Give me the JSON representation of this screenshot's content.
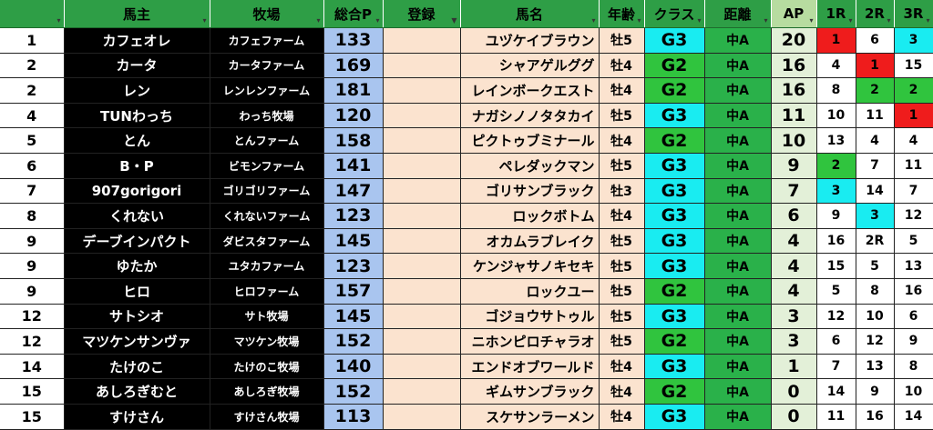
{
  "headers": {
    "rank": "",
    "owner": "馬主",
    "farm": "牧場",
    "points": "総合P",
    "register": "登録",
    "horse": "馬名",
    "age": "年齢",
    "class": "クラス",
    "distance": "距離",
    "ap": "AP",
    "r1": "1R",
    "r2": "2R",
    "r3": "3R"
  },
  "filter_icon": "▾",
  "rows": [
    {
      "rank": "1",
      "owner": "カフェオレ",
      "farm": "カフェファーム",
      "points": "133",
      "register": "",
      "horse": "ユヅケイブラウン",
      "age": "牡5",
      "class": "G3",
      "distance": "中A",
      "ap": "20",
      "r1": "1",
      "r2": "6",
      "r3": "3"
    },
    {
      "rank": "2",
      "owner": "カータ",
      "farm": "カータファーム",
      "points": "169",
      "register": "",
      "horse": "シャアゲルググ",
      "age": "牡4",
      "class": "G2",
      "distance": "中A",
      "ap": "16",
      "r1": "4",
      "r2": "1",
      "r3": "15"
    },
    {
      "rank": "2",
      "owner": "レン",
      "farm": "レンレンファーム",
      "points": "181",
      "register": "",
      "horse": "レインボークエスト",
      "age": "牡4",
      "class": "G2",
      "distance": "中A",
      "ap": "16",
      "r1": "8",
      "r2": "2",
      "r3": "2"
    },
    {
      "rank": "4",
      "owner": "TUNわっち",
      "farm": "わっち牧場",
      "points": "120",
      "register": "",
      "horse": "ナガシノノタタカイ",
      "age": "牡5",
      "class": "G3",
      "distance": "中A",
      "ap": "11",
      "r1": "10",
      "r2": "11",
      "r3": "1"
    },
    {
      "rank": "5",
      "owner": "とん",
      "farm": "とんファーム",
      "points": "158",
      "register": "",
      "horse": "ピクトゥブミナール",
      "age": "牡4",
      "class": "G2",
      "distance": "中A",
      "ap": "10",
      "r1": "13",
      "r2": "4",
      "r3": "4"
    },
    {
      "rank": "6",
      "owner": "B・P",
      "farm": "ビモンファーム",
      "points": "141",
      "register": "",
      "horse": "ペレダックマン",
      "age": "牡5",
      "class": "G3",
      "distance": "中A",
      "ap": "9",
      "r1": "2",
      "r2": "7",
      "r3": "11"
    },
    {
      "rank": "7",
      "owner": "907gorigori",
      "farm": "ゴリゴリファーム",
      "points": "147",
      "register": "",
      "horse": "ゴリサンブラック",
      "age": "牡3",
      "class": "G3",
      "distance": "中A",
      "ap": "7",
      "r1": "3",
      "r2": "14",
      "r3": "7"
    },
    {
      "rank": "8",
      "owner": "くれない",
      "farm": "くれないファーム",
      "points": "123",
      "register": "",
      "horse": "ロックボトム",
      "age": "牡4",
      "class": "G3",
      "distance": "中A",
      "ap": "6",
      "r1": "9",
      "r2": "3",
      "r3": "12"
    },
    {
      "rank": "9",
      "owner": "デーブインパクト",
      "farm": "ダビスタファーム",
      "points": "145",
      "register": "",
      "horse": "オカムラブレイク",
      "age": "牡5",
      "class": "G3",
      "distance": "中A",
      "ap": "4",
      "r1": "16",
      "r2": "2R",
      "r3": "5"
    },
    {
      "rank": "9",
      "owner": "ゆたか",
      "farm": "ユタカファーム",
      "points": "123",
      "register": "",
      "horse": "ケンジャサノキセキ",
      "age": "牡5",
      "class": "G3",
      "distance": "中A",
      "ap": "4",
      "r1": "15",
      "r2": "5",
      "r3": "13"
    },
    {
      "rank": "9",
      "owner": "ヒロ",
      "farm": "ヒロファーム",
      "points": "157",
      "register": "",
      "horse": "ロックユー",
      "age": "牡5",
      "class": "G2",
      "distance": "中A",
      "ap": "4",
      "r1": "5",
      "r2": "8",
      "r3": "16"
    },
    {
      "rank": "12",
      "owner": "サトシオ",
      "farm": "サト牧場",
      "points": "145",
      "register": "",
      "horse": "ゴジョウサトゥル",
      "age": "牡5",
      "class": "G3",
      "distance": "中A",
      "ap": "3",
      "r1": "12",
      "r2": "10",
      "r3": "6"
    },
    {
      "rank": "12",
      "owner": "マツケンサンヴァ",
      "farm": "マツケン牧場",
      "points": "152",
      "register": "",
      "horse": "ニホンピロチャラオ",
      "age": "牡5",
      "class": "G2",
      "distance": "中A",
      "ap": "3",
      "r1": "6",
      "r2": "12",
      "r3": "9"
    },
    {
      "rank": "14",
      "owner": "たけのこ",
      "farm": "たけのこ牧場",
      "points": "140",
      "register": "",
      "horse": "エンドオブワールド",
      "age": "牡4",
      "class": "G3",
      "distance": "中A",
      "ap": "1",
      "r1": "7",
      "r2": "13",
      "r3": "8"
    },
    {
      "rank": "15",
      "owner": "あしろぎむと",
      "farm": "あしろぎ牧場",
      "points": "152",
      "register": "",
      "horse": "ギムサンブラック",
      "age": "牡4",
      "class": "G2",
      "distance": "中A",
      "ap": "0",
      "r1": "14",
      "r2": "9",
      "r3": "10"
    },
    {
      "rank": "15",
      "owner": "すけさん",
      "farm": "すけさん牧場",
      "points": "113",
      "register": "",
      "horse": "スケサンラーメン",
      "age": "牡4",
      "class": "G3",
      "distance": "中A",
      "ap": "0",
      "r1": "11",
      "r2": "16",
      "r3": "14"
    }
  ]
}
